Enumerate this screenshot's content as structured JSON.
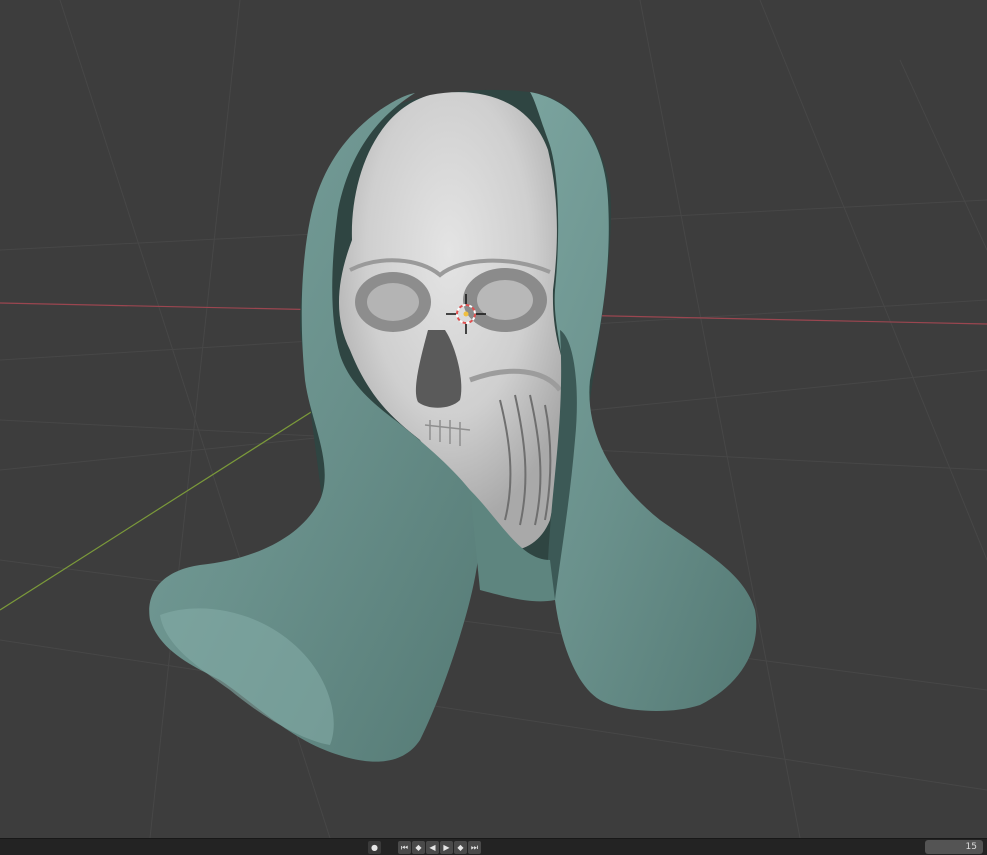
{
  "viewport": {
    "background": "#3d3d3d",
    "grid_color": "#4a4a4a",
    "x_axis_color": "#9b4650",
    "y_axis_color": "#7b9a3a",
    "cloth_color": "#6f9691",
    "skull_color": "#d6d6d6",
    "objects": [
      "skull-mesh",
      "hood-cloth-mesh"
    ],
    "cursor_icon": "3d-cursor-icon"
  },
  "timeline": {
    "buttons": [
      {
        "name": "record-button",
        "icon": "record-icon",
        "glyph": "●"
      },
      {
        "name": "jump-start-button",
        "icon": "jump-start-icon",
        "glyph": "⏮"
      },
      {
        "name": "prev-keyframe-button",
        "icon": "prev-keyframe-icon",
        "glyph": "◆"
      },
      {
        "name": "play-reverse-button",
        "icon": "play-reverse-icon",
        "glyph": "◀"
      },
      {
        "name": "play-button",
        "icon": "play-icon",
        "glyph": "▶"
      },
      {
        "name": "next-keyframe-button",
        "icon": "next-keyframe-icon",
        "glyph": "◆"
      },
      {
        "name": "jump-end-button",
        "icon": "jump-end-icon",
        "glyph": "⏭"
      }
    ],
    "current_frame": "15"
  }
}
